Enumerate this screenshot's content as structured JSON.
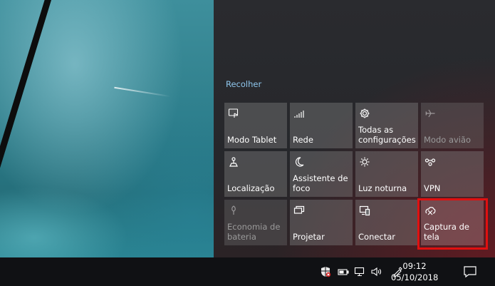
{
  "action_center": {
    "collapse_label": "Recolher",
    "tiles": [
      {
        "label": "Modo Tablet",
        "icon": "tablet-mode-icon",
        "enabled": true
      },
      {
        "label": "Rede",
        "icon": "network-icon",
        "enabled": true
      },
      {
        "label": "Todas as configurações",
        "icon": "gear-icon",
        "enabled": true
      },
      {
        "label": "Modo avião",
        "icon": "airplane-icon",
        "enabled": false
      },
      {
        "label": "Localização",
        "icon": "location-icon",
        "enabled": true
      },
      {
        "label": "Assistente de foco",
        "icon": "moon-icon",
        "enabled": true
      },
      {
        "label": "Luz noturna",
        "icon": "brightness-icon",
        "enabled": true
      },
      {
        "label": "VPN",
        "icon": "vpn-icon",
        "enabled": true
      },
      {
        "label": "Economia de bateria",
        "icon": "battery-saver-icon",
        "enabled": false
      },
      {
        "label": "Projetar",
        "icon": "project-icon",
        "enabled": true
      },
      {
        "label": "Conectar",
        "icon": "connect-icon",
        "enabled": true
      },
      {
        "label": "Captura de tela",
        "icon": "screen-snip-icon",
        "enabled": true
      }
    ],
    "highlight_color": "#e01010"
  },
  "taskbar": {
    "time": "09:12",
    "date": "05/10/2018",
    "tray_icons": [
      "windows-security-icon",
      "battery-icon",
      "network-icon",
      "volume-icon",
      "pen-icon",
      "notification-icon"
    ]
  }
}
